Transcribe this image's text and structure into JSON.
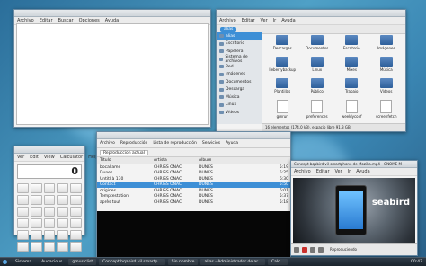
{
  "editor": {
    "menu": [
      "Archivo",
      "Editar",
      "Buscar",
      "Opciones",
      "Ayuda"
    ]
  },
  "files": {
    "menu": [
      "Archivo",
      "Editar",
      "Ver",
      "Ir",
      "Ayuda"
    ],
    "location": "alias",
    "sidebar": [
      {
        "label": "alias",
        "selected": true
      },
      {
        "label": "Escritorio"
      },
      {
        "label": "Papelera"
      },
      {
        "label": "Sistema de archivos"
      },
      {
        "label": "Red"
      },
      {
        "label": "Imágenes"
      },
      {
        "label": "Documentos"
      },
      {
        "label": "Descarga"
      },
      {
        "label": "Música"
      },
      {
        "label": "Linux"
      },
      {
        "label": "Vídeos"
      }
    ],
    "items": [
      {
        "name": "Descargas",
        "type": "folder"
      },
      {
        "name": "Documentos",
        "type": "folder"
      },
      {
        "name": "Escritorio",
        "type": "folder"
      },
      {
        "name": "Imágenes",
        "type": "folder"
      },
      {
        "name": "liebertybackup",
        "type": "folder"
      },
      {
        "name": "Linux",
        "type": "folder"
      },
      {
        "name": "Mixes",
        "type": "folder"
      },
      {
        "name": "Música",
        "type": "folder"
      },
      {
        "name": "Plantillas",
        "type": "folder"
      },
      {
        "name": "Público",
        "type": "folder"
      },
      {
        "name": "Trabajo",
        "type": "folder"
      },
      {
        "name": "Vídeos",
        "type": "folder"
      },
      {
        "name": "gmrun",
        "type": "doc"
      },
      {
        "name": "preferences",
        "type": "doc"
      },
      {
        "name": "weeklyconf",
        "type": "doc"
      },
      {
        "name": "screenfetch",
        "type": "doc"
      }
    ],
    "status": "16 elementos (174,0 kB), espacio libre 91,3 GB"
  },
  "calc": {
    "menu": [
      "Ver",
      "Edit",
      "View",
      "Calculator",
      "Help"
    ],
    "display": "0",
    "key_count": 30
  },
  "music": {
    "tabs": [
      "Archivo",
      "Reproducción",
      "Lista de reproducción",
      "Servicios",
      "Ayuda"
    ],
    "playlist_tab": "Reproduccion actual",
    "columns": [
      "Título",
      "Artista",
      "Álbum",
      ""
    ],
    "rows": [
      {
        "title": "bocallame",
        "artist": "CHRISS ONAC",
        "album": "DUNES",
        "time": "5:19"
      },
      {
        "title": "Dunes",
        "artist": "CHRISS ONAC",
        "album": "DUNES",
        "time": "5:25"
      },
      {
        "title": "Untitl à 130",
        "artist": "CHRISS ONAC",
        "album": "DUNES",
        "time": "6:30"
      },
      {
        "title": "Contact",
        "artist": "CHRISS ONAC",
        "album": "DUNES",
        "time": "5:50",
        "selected": true
      },
      {
        "title": "origines",
        "artist": "CHRISS ONAC",
        "album": "DUNES",
        "time": "6:01"
      },
      {
        "title": "Temptestation",
        "artist": "CHRISS ONAC",
        "album": "DUNES",
        "time": "5:37"
      },
      {
        "title": "après tout",
        "artist": "CHRISS ONAC",
        "album": "DUNES",
        "time": "5:18"
      }
    ]
  },
  "video": {
    "title": "Concept bqabird vil smartphone de Mozilla.mp4 - GNOME M",
    "menu": [
      "Archivo",
      "Editar",
      "Ver",
      "Ir",
      "Ayuda"
    ],
    "brand": "seabird",
    "control_label": "Reproduciendo"
  },
  "taskbar": {
    "items": [
      "Sistema",
      "Audacious",
      "gmusiclist",
      "Concept bqabird vil smartp...",
      "Sin nombre",
      "alias - Administrador de ar...",
      "Calc..."
    ],
    "clock": "00:47"
  }
}
